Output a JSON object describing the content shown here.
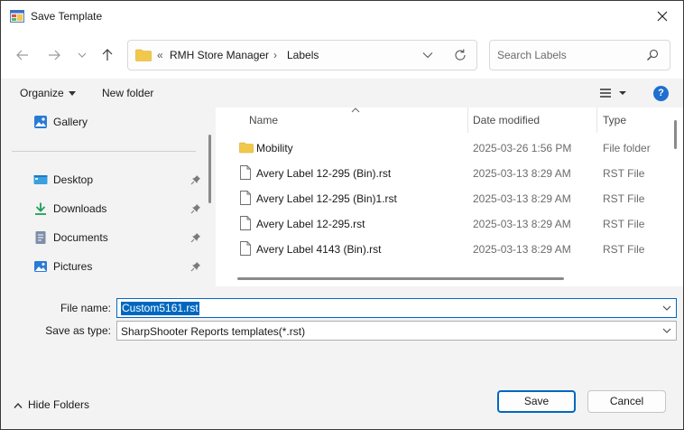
{
  "window": {
    "title": "Save Template"
  },
  "address_bar": {
    "overflow_glyph": "«",
    "crumbs": [
      "RMH Store Manager",
      "Labels"
    ],
    "separator": "›"
  },
  "search": {
    "placeholder": "Search Labels"
  },
  "command_bar": {
    "organize_label": "Organize",
    "new_folder_label": "New folder",
    "help_glyph": "?"
  },
  "nav_pane": {
    "items": [
      {
        "label": "Gallery",
        "icon": "gallery-icon",
        "pinned": false
      },
      {
        "label": "Desktop",
        "icon": "desktop-icon",
        "pinned": true
      },
      {
        "label": "Downloads",
        "icon": "downloads-icon",
        "pinned": true
      },
      {
        "label": "Documents",
        "icon": "documents-icon",
        "pinned": true
      },
      {
        "label": "Pictures",
        "icon": "pictures-icon",
        "pinned": true
      }
    ]
  },
  "file_list": {
    "columns": {
      "name": "Name",
      "date": "Date modified",
      "type": "Type"
    },
    "rows": [
      {
        "name": "Mobility",
        "date": "2025-03-26 1:56 PM",
        "type": "File folder",
        "icon": "folder-icon"
      },
      {
        "name": "Avery Label 12-295 (Bin).rst",
        "date": "2025-03-13 8:29 AM",
        "type": "RST File",
        "icon": "file-icon"
      },
      {
        "name": "Avery Label 12-295 (Bin)1.rst",
        "date": "2025-03-13 8:29 AM",
        "type": "RST File",
        "icon": "file-icon"
      },
      {
        "name": "Avery Label 12-295.rst",
        "date": "2025-03-13 8:29 AM",
        "type": "RST File",
        "icon": "file-icon"
      },
      {
        "name": "Avery Label 4143 (Bin).rst",
        "date": "2025-03-13 8:29 AM",
        "type": "RST File",
        "icon": "file-icon"
      }
    ]
  },
  "form": {
    "file_name_label": "File name:",
    "file_name_value": "Custom5161.rst",
    "save_type_label": "Save as type:",
    "save_type_value": "SharpShooter Reports templates(*.rst)"
  },
  "footer": {
    "hide_folders_label": "Hide Folders",
    "save_label": "Save",
    "cancel_label": "Cancel"
  },
  "colors": {
    "accent": "#0067c0",
    "folder": "#f2c84b",
    "background": "#f3f3f3"
  }
}
